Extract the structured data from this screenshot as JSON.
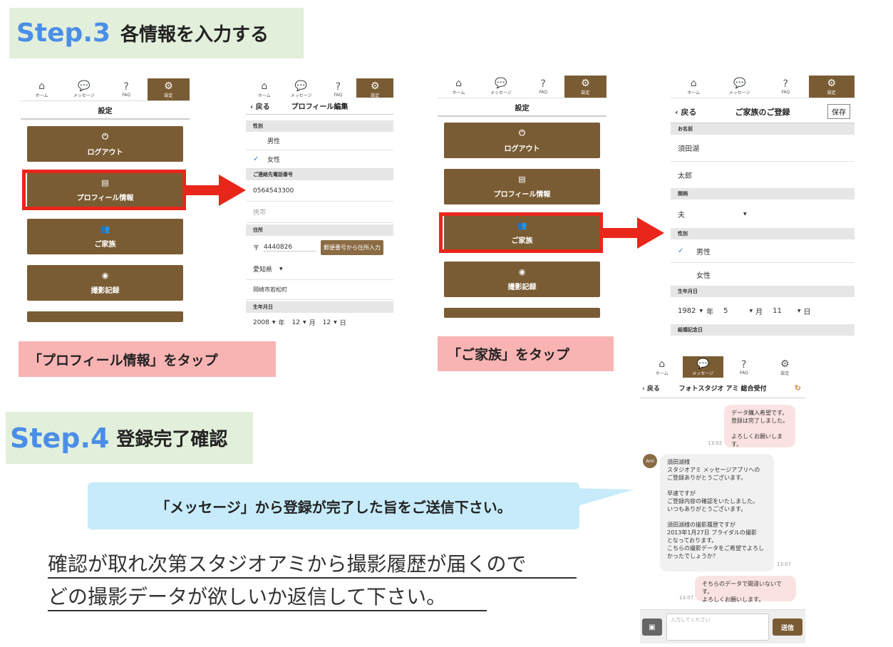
{
  "step3": {
    "num": "Step.3",
    "title": "各情報を入力する"
  },
  "step4": {
    "num": "Step.4",
    "title": "登録完了確認"
  },
  "tabs": {
    "home": "ホーム",
    "message": "メッセージ",
    "faq": "FAQ",
    "settings": "設定"
  },
  "settings_screen": {
    "title": "設定",
    "buttons": [
      {
        "label": "ログアウト",
        "icon": "power-icon"
      },
      {
        "label": "プロフィール情報",
        "icon": "clipboard-icon"
      },
      {
        "label": "ご家族",
        "icon": "people-icon"
      },
      {
        "label": "撮影記録",
        "icon": "camera-icon"
      }
    ]
  },
  "profile_screen": {
    "back": "戻る",
    "title": "プロフィール編集",
    "gender_header": "性別",
    "male": "男性",
    "female": "女性",
    "phone_header": "ご連絡先電話番号",
    "phone": "0564543300",
    "mobile_placeholder": "携帯",
    "address_header": "住所",
    "postal_mark": "〒",
    "postal": "4440826",
    "postal_button": "郵便番号から住所入力",
    "prefecture": "愛知県",
    "city": "岡崎市若松町",
    "birth_header": "生年月日",
    "birth_year": "2008",
    "birth_month": "12",
    "birth_day": "12",
    "unit_year": "年",
    "unit_month": "月",
    "unit_day": "日"
  },
  "family_screen": {
    "back": "戻る",
    "title": "ご家族のご登録",
    "save": "保存",
    "name_header": "お名前",
    "last_name": "須田湖",
    "first_name": "太郎",
    "relation_header": "関柄",
    "relation": "夫",
    "gender_header": "性別",
    "male": "男性",
    "female": "女性",
    "birth_header": "生年月日",
    "birth_year": "1982",
    "birth_month": "5",
    "birth_day": "11",
    "unit_year": "年",
    "unit_month": "月",
    "unit_day": "日",
    "anniversary_header": "結婚記念日"
  },
  "labels": {
    "tap_profile": "「プロフィール情報」をタップ",
    "tap_family": "「ご家族」をタップ",
    "send_message": "「メッセージ」から登録が完了した旨をご送信下さい。",
    "note_line1": "確認が取れ次第スタジオアミから撮影履歴が届くので",
    "note_line2": "どの撮影データが欲しいか返信して下さい。"
  },
  "chat": {
    "back": "戻る",
    "title": "フォトスタジオ アミ 総合受付",
    "msg1": "データ購入希望です。\n登録は完了しました。\n\nよろしくお願いします。",
    "time1": "13:02",
    "msg2": "須田湖様\nスタジオアミ メッセージアプリへの\nご登録ありがとうございます。\n\n早速ですが\nご登録内容の確認をいたしました。\nいつもありがとうございます。\n\n須田湖様の撮影履歴ですが\n2013年1月27日 ブライダルの撮影\nとなっております。\nこちらの撮影データをご希望でよろし\nかったでしょうか？",
    "time2": "13:07",
    "msg3": "そちらのデータで間違いないです。\nよろしくお願いします。",
    "time3": "13:07",
    "input_placeholder": "入力してください",
    "send": "送信",
    "avatar_text": "Ami"
  },
  "colors": {
    "brand": "#7a5c34",
    "accent_red": "#e8261a",
    "step_blue": "#4a8ee8"
  }
}
